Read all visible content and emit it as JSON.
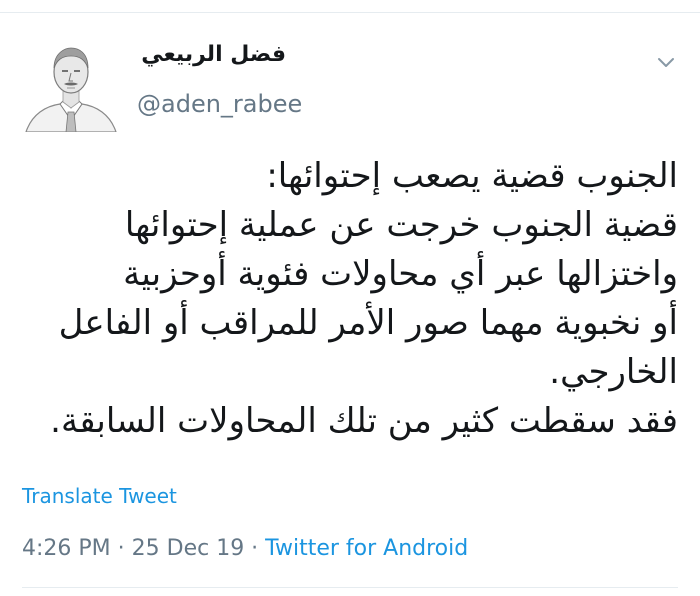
{
  "user": {
    "display_name": "فضل الربيعي",
    "handle": "@aden_rabee",
    "avatar_icon": "person-sketch-avatar"
  },
  "menu": {
    "icon": "chevron-down-icon"
  },
  "tweet": {
    "lines": [
      "الجنوب قضية يصعب إحتوائها:",
      "قضية الجنوب خرجت عن عملية إحتوائها",
      "واختزالها عبر أي محاولات فئوية أوحزبية",
      "أو نخبوية مهما صور الأمر للمراقب أو الفاعل",
      "الخارجي.",
      "فقد سقطت كثير من تلك المحاولات السابقة."
    ]
  },
  "translate_label": "Translate Tweet",
  "meta": {
    "time": "4:26 PM",
    "sep1": " · ",
    "date": "25 Dec 19",
    "sep2": " · ",
    "source": "Twitter for Android"
  },
  "colors": {
    "link": "#1b95e0",
    "muted": "#657786",
    "text": "#14171a",
    "divider": "#e6ecf0"
  }
}
